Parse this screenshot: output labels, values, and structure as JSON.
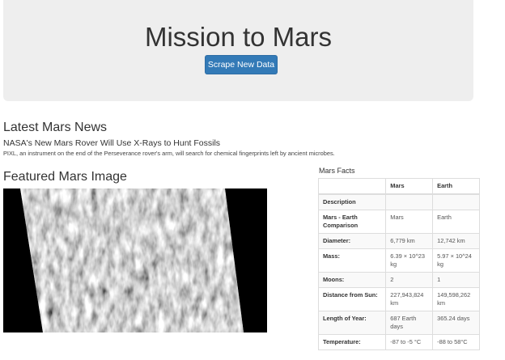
{
  "header": {
    "title": "Mission to Mars",
    "scrape_button": "Scrape New Data"
  },
  "news": {
    "heading": "Latest Mars News",
    "title": "NASA's New Mars Rover Will Use X-Rays to Hunt Fossils",
    "paragraph": "PIXL, an instrument on the end of the Perseverance rover's arm, will search for chemical fingerprints left by ancient microbes."
  },
  "featured": {
    "heading": "Featured Mars Image"
  },
  "facts": {
    "heading": "Mars Facts",
    "columns": [
      "",
      "Mars",
      "Earth"
    ],
    "rows": [
      {
        "label": "Description",
        "mars": "",
        "earth": ""
      },
      {
        "label": "Mars - Earth Comparison",
        "mars": "Mars",
        "earth": "Earth"
      },
      {
        "label": "Diameter:",
        "mars": "6,779 km",
        "earth": "12,742 km"
      },
      {
        "label": "Mass:",
        "mars": "6.39 × 10^23 kg",
        "earth": "5.97 × 10^24 kg"
      },
      {
        "label": "Moons:",
        "mars": "2",
        "earth": "1"
      },
      {
        "label": "Distance from Sun:",
        "mars": "227,943,824 km",
        "earth": "149,598,262 km"
      },
      {
        "label": "Length of Year:",
        "mars": "687 Earth days",
        "earth": "365.24 days"
      },
      {
        "label": "Temperature:",
        "mars": "-87 to -5 °C",
        "earth": "-88 to 58°C"
      }
    ]
  },
  "colors": {
    "jumbotron_bg": "#eeeeee",
    "button_primary": "#337ab7"
  }
}
